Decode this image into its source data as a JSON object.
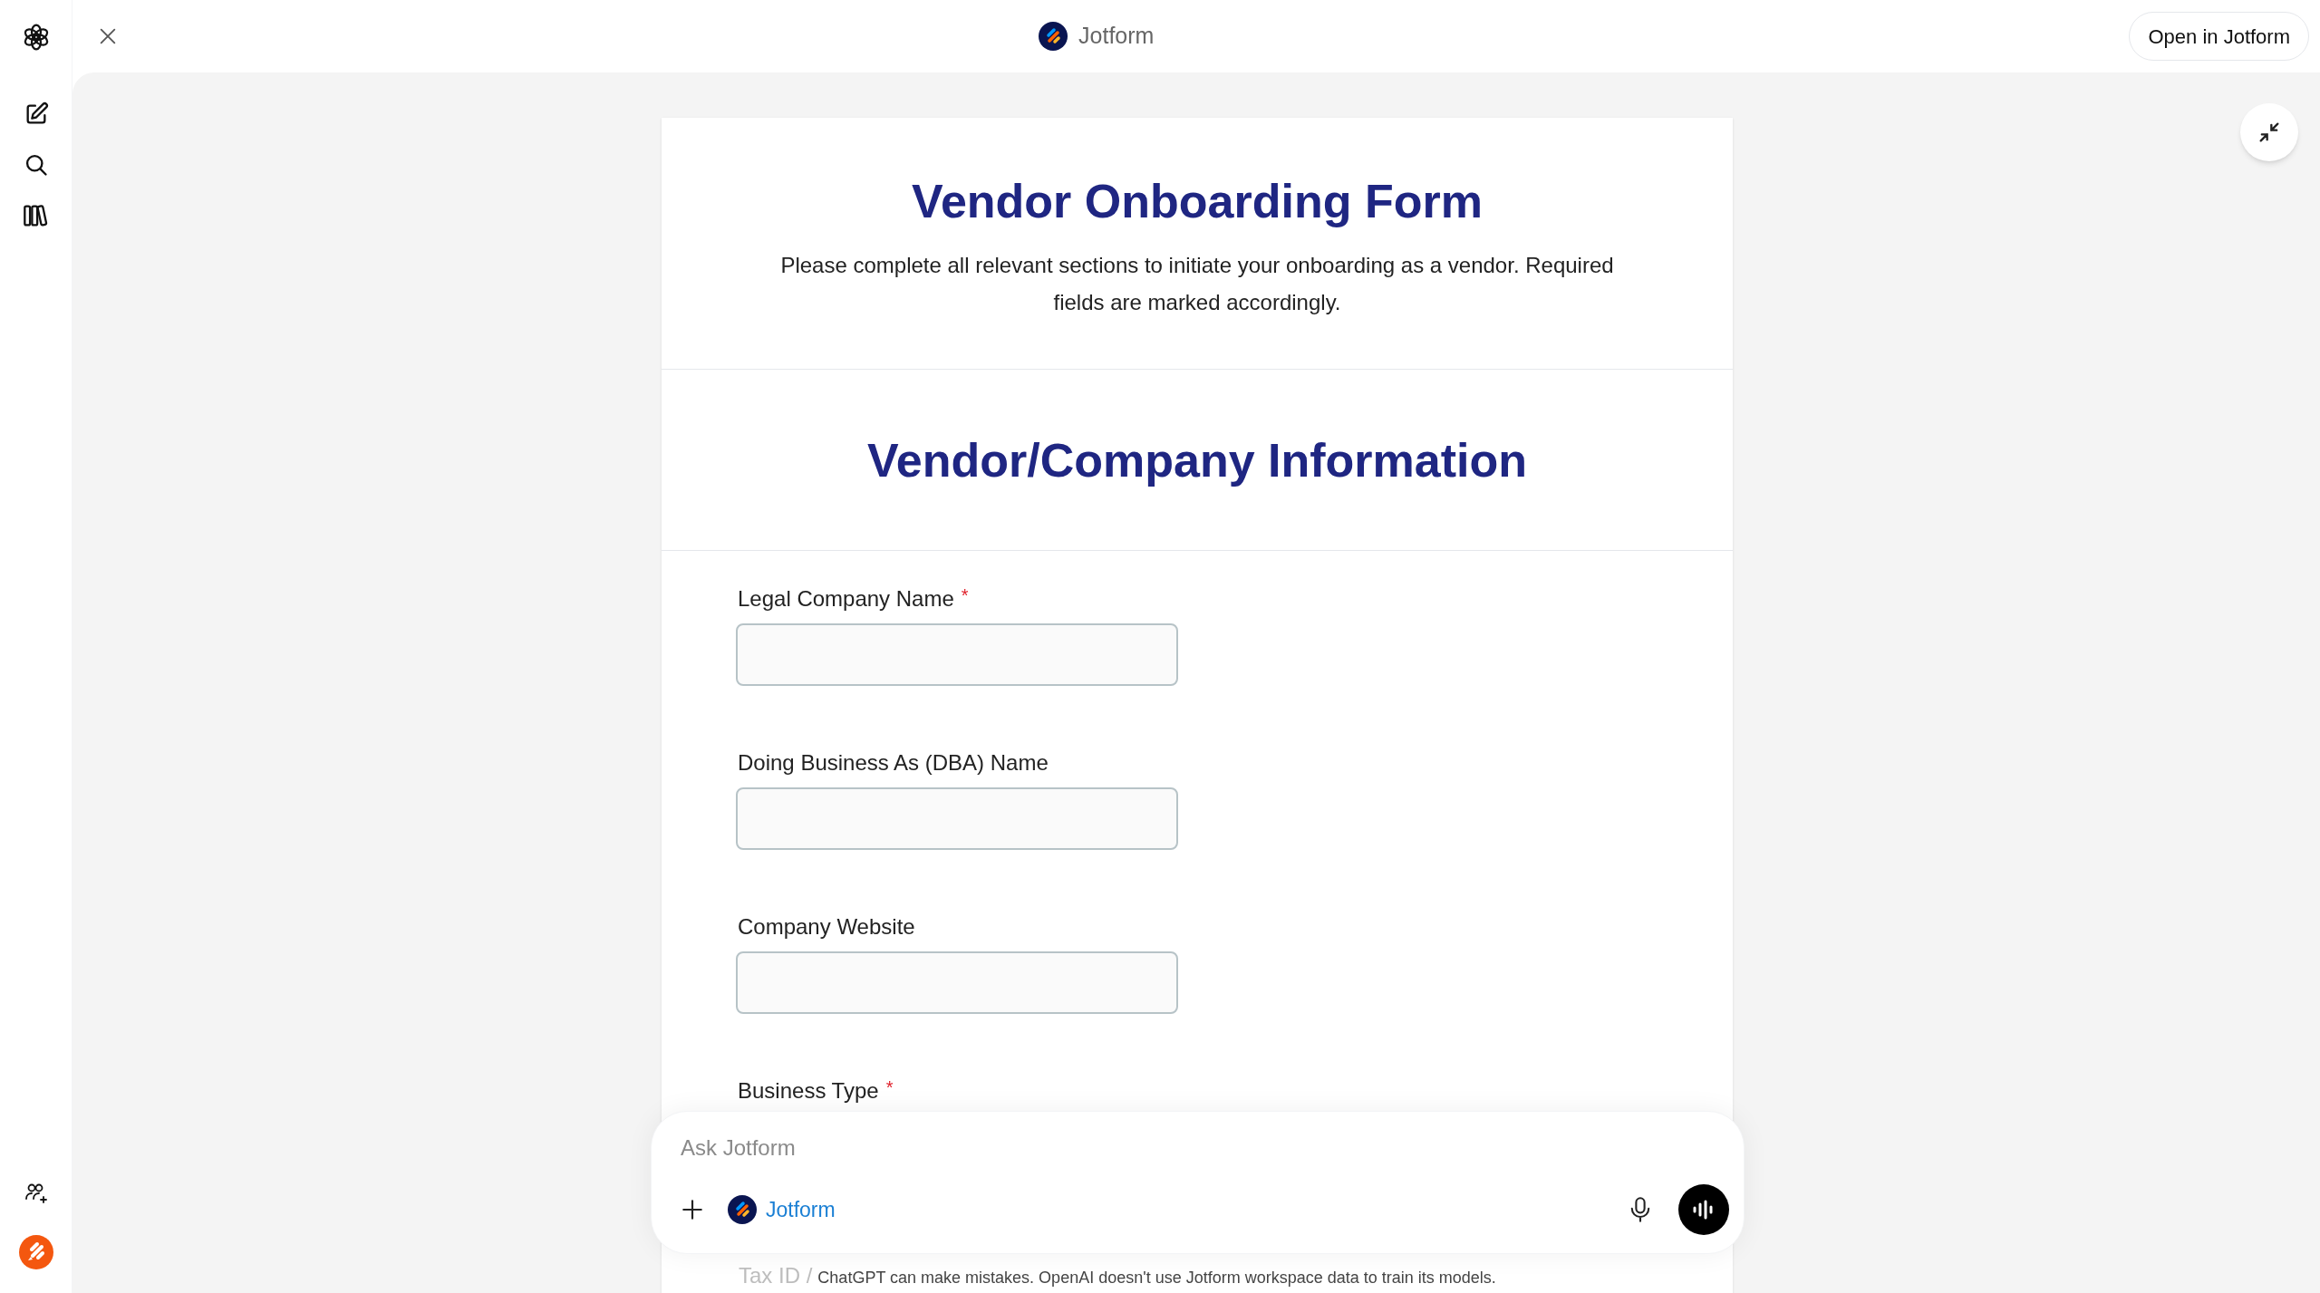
{
  "header": {
    "title": "Jotform",
    "open_button": "Open in Jotform"
  },
  "form": {
    "title": "Vendor Onboarding Form",
    "description": "Please complete all relevant sections to initiate your onboarding as a vendor. Required fields are marked accordingly.",
    "section_title": "Vendor/Company Information",
    "required_mark": "*",
    "fields": [
      {
        "label": "Legal Company Name",
        "required": true,
        "kind": "text"
      },
      {
        "label": "Doing Business As (DBA) Name",
        "required": false,
        "kind": "text"
      },
      {
        "label": "Company Website",
        "required": false,
        "kind": "text"
      },
      {
        "label": "Business Type",
        "required": true,
        "kind": "label_only"
      }
    ]
  },
  "composer": {
    "placeholder": "Ask Jotform",
    "app_chip": "Jotform"
  },
  "footer": {
    "partial_label": "Tax ID /",
    "disclaimer": "ChatGPT can make mistakes. OpenAI doesn't use Jotform workspace data to train its models."
  }
}
